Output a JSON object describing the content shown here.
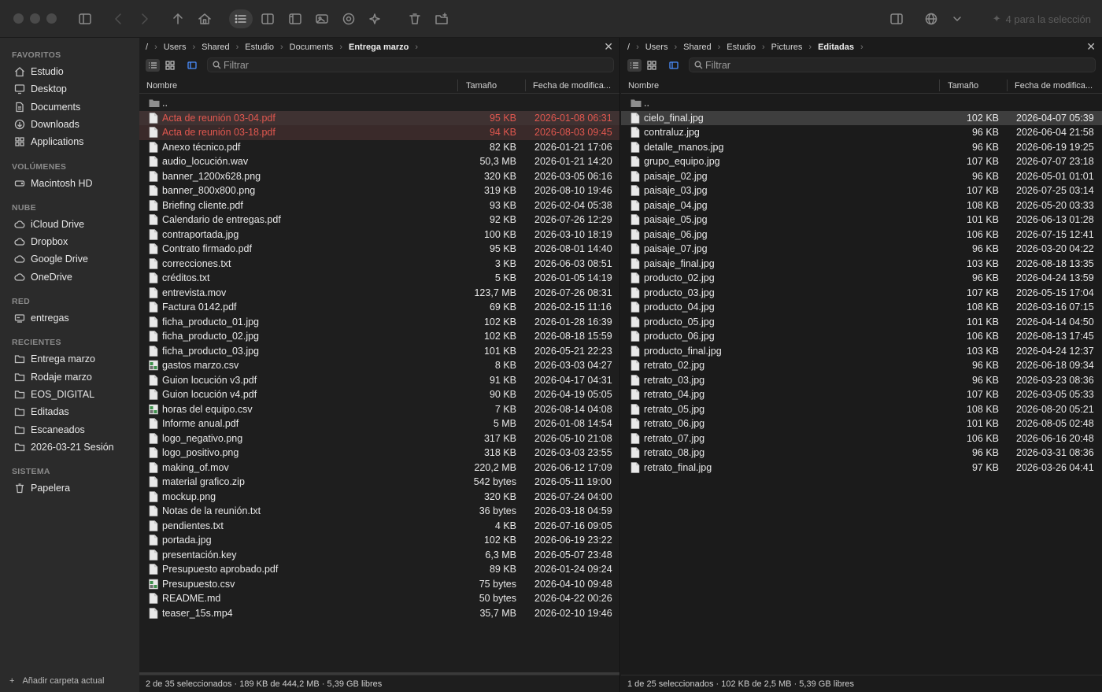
{
  "toolbar": {
    "selection_label": "4 para la selección"
  },
  "sidebar": {
    "sections": [
      {
        "title": "FAVORITOS",
        "items": [
          {
            "label": "Estudio",
            "icon": "home-icon"
          },
          {
            "label": "Desktop",
            "icon": "desktop-icon"
          },
          {
            "label": "Documents",
            "icon": "document-icon"
          },
          {
            "label": "Downloads",
            "icon": "download-icon"
          },
          {
            "label": "Applications",
            "icon": "apps-icon"
          }
        ]
      },
      {
        "title": "VOLÚMENES",
        "items": [
          {
            "label": "Macintosh HD",
            "icon": "drive-icon"
          }
        ]
      },
      {
        "title": "NUBE",
        "items": [
          {
            "label": "iCloud Drive",
            "icon": "cloud-icon"
          },
          {
            "label": "Dropbox",
            "icon": "cloud-icon"
          },
          {
            "label": "Google Drive",
            "icon": "cloud-icon"
          },
          {
            "label": "OneDrive",
            "icon": "cloud-icon"
          }
        ]
      },
      {
        "title": "RED",
        "items": [
          {
            "label": "entregas",
            "icon": "network-drive-icon"
          }
        ]
      },
      {
        "title": "RECIENTES",
        "items": [
          {
            "label": "Entrega marzo",
            "icon": "folder-icon"
          },
          {
            "label": "Rodaje marzo",
            "icon": "folder-icon"
          },
          {
            "label": "EOS_DIGITAL",
            "icon": "folder-icon"
          },
          {
            "label": "Editadas",
            "icon": "folder-icon"
          },
          {
            "label": "Escaneados",
            "icon": "folder-icon"
          },
          {
            "label": "2026-03-21 Sesión",
            "icon": "folder-icon"
          }
        ]
      },
      {
        "title": "SISTEMA",
        "items": [
          {
            "label": "Papelera",
            "icon": "trash-icon"
          }
        ]
      }
    ],
    "add_label": "Añadir carpeta actual"
  },
  "left_pane": {
    "breadcrumb": [
      "/",
      "Users",
      "Shared",
      "Estudio",
      "Documents",
      "Entrega marzo"
    ],
    "filter_placeholder": "Filtrar",
    "columns": {
      "name": "Nombre",
      "size": "Tamaño",
      "date": "Fecha de modifica..."
    },
    "parent": "..",
    "files": [
      {
        "name": "Acta de reunión 03-04.pdf",
        "size": "95 KB",
        "date": "2026-01-08 06:31",
        "state": "selected-red",
        "icon": "doc"
      },
      {
        "name": "Acta de reunión 03-18.pdf",
        "size": "94 KB",
        "date": "2026-08-03 09:45",
        "state": "red",
        "icon": "doc"
      },
      {
        "name": "Anexo técnico.pdf",
        "size": "82 KB",
        "date": "2026-01-21 17:06",
        "state": "",
        "icon": "doc"
      },
      {
        "name": "audio_locución.wav",
        "size": "50,3 MB",
        "date": "2026-01-21 14:20",
        "state": "",
        "icon": "doc"
      },
      {
        "name": "banner_1200x628.png",
        "size": "320 KB",
        "date": "2026-03-05 06:16",
        "state": "",
        "icon": "doc"
      },
      {
        "name": "banner_800x800.png",
        "size": "319 KB",
        "date": "2026-08-10 19:46",
        "state": "",
        "icon": "doc"
      },
      {
        "name": "Briefing cliente.pdf",
        "size": "93 KB",
        "date": "2026-02-04 05:38",
        "state": "",
        "icon": "doc"
      },
      {
        "name": "Calendario de entregas.pdf",
        "size": "92 KB",
        "date": "2026-07-26 12:29",
        "state": "",
        "icon": "doc"
      },
      {
        "name": "contraportada.jpg",
        "size": "100 KB",
        "date": "2026-03-10 18:19",
        "state": "",
        "icon": "doc"
      },
      {
        "name": "Contrato firmado.pdf",
        "size": "95 KB",
        "date": "2026-08-01 14:40",
        "state": "",
        "icon": "doc"
      },
      {
        "name": "correcciones.txt",
        "size": "3 KB",
        "date": "2026-06-03 08:51",
        "state": "",
        "icon": "doc"
      },
      {
        "name": "créditos.txt",
        "size": "5 KB",
        "date": "2026-01-05 14:19",
        "state": "",
        "icon": "doc"
      },
      {
        "name": "entrevista.mov",
        "size": "123,7 MB",
        "date": "2026-07-26 08:31",
        "state": "",
        "icon": "doc"
      },
      {
        "name": "Factura 0142.pdf",
        "size": "69 KB",
        "date": "2026-02-15 11:16",
        "state": "",
        "icon": "doc"
      },
      {
        "name": "ficha_producto_01.jpg",
        "size": "102 KB",
        "date": "2026-01-28 16:39",
        "state": "",
        "icon": "doc"
      },
      {
        "name": "ficha_producto_02.jpg",
        "size": "102 KB",
        "date": "2026-08-18 15:59",
        "state": "",
        "icon": "doc"
      },
      {
        "name": "ficha_producto_03.jpg",
        "size": "101 KB",
        "date": "2026-05-21 22:23",
        "state": "",
        "icon": "doc"
      },
      {
        "name": "gastos marzo.csv",
        "size": "8 KB",
        "date": "2026-03-03 04:27",
        "state": "",
        "icon": "sheet"
      },
      {
        "name": "Guion locución v3.pdf",
        "size": "91 KB",
        "date": "2026-04-17 04:31",
        "state": "",
        "icon": "doc"
      },
      {
        "name": "Guion locución v4.pdf",
        "size": "90 KB",
        "date": "2026-04-19 05:05",
        "state": "",
        "icon": "doc"
      },
      {
        "name": "horas del equipo.csv",
        "size": "7 KB",
        "date": "2026-08-14 04:08",
        "state": "",
        "icon": "sheet"
      },
      {
        "name": "Informe anual.pdf",
        "size": "5 MB",
        "date": "2026-01-08 14:54",
        "state": "",
        "icon": "doc"
      },
      {
        "name": "logo_negativo.png",
        "size": "317 KB",
        "date": "2026-05-10 21:08",
        "state": "",
        "icon": "doc"
      },
      {
        "name": "logo_positivo.png",
        "size": "318 KB",
        "date": "2026-03-03 23:55",
        "state": "",
        "icon": "doc"
      },
      {
        "name": "making_of.mov",
        "size": "220,2 MB",
        "date": "2026-06-12 17:09",
        "state": "",
        "icon": "doc"
      },
      {
        "name": "material grafico.zip",
        "size": "542 bytes",
        "date": "2026-05-11 19:00",
        "state": "",
        "icon": "doc"
      },
      {
        "name": "mockup.png",
        "size": "320 KB",
        "date": "2026-07-24 04:00",
        "state": "",
        "icon": "doc"
      },
      {
        "name": "Notas de la reunión.txt",
        "size": "36 bytes",
        "date": "2026-03-18 04:59",
        "state": "",
        "icon": "doc"
      },
      {
        "name": "pendientes.txt",
        "size": "4 KB",
        "date": "2026-07-16 09:05",
        "state": "",
        "icon": "doc"
      },
      {
        "name": "portada.jpg",
        "size": "102 KB",
        "date": "2026-06-19 23:22",
        "state": "",
        "icon": "doc"
      },
      {
        "name": "presentación.key",
        "size": "6,3 MB",
        "date": "2026-05-07 23:48",
        "state": "",
        "icon": "doc"
      },
      {
        "name": "Presupuesto aprobado.pdf",
        "size": "89 KB",
        "date": "2026-01-24 09:24",
        "state": "",
        "icon": "doc"
      },
      {
        "name": "Presupuesto.csv",
        "size": "75 bytes",
        "date": "2026-04-10 09:48",
        "state": "",
        "icon": "sheet"
      },
      {
        "name": "README.md",
        "size": "50 bytes",
        "date": "2026-04-22 00:26",
        "state": "",
        "icon": "doc"
      },
      {
        "name": "teaser_15s.mp4",
        "size": "35,7 MB",
        "date": "2026-02-10 19:46",
        "state": "",
        "icon": "doc"
      }
    ],
    "status": "2 de 35 seleccionados · 189 KB de 444,2 MB · 5,39 GB libres"
  },
  "right_pane": {
    "breadcrumb": [
      "/",
      "Users",
      "Shared",
      "Estudio",
      "Pictures",
      "Editadas"
    ],
    "filter_placeholder": "Filtrar",
    "columns": {
      "name": "Nombre",
      "size": "Tamaño",
      "date": "Fecha de modifica..."
    },
    "parent": "..",
    "files": [
      {
        "name": "cielo_final.jpg",
        "size": "102 KB",
        "date": "2026-04-07 05:39",
        "state": "selected",
        "icon": "doc"
      },
      {
        "name": "contraluz.jpg",
        "size": "96 KB",
        "date": "2026-06-04 21:58",
        "state": "",
        "icon": "doc"
      },
      {
        "name": "detalle_manos.jpg",
        "size": "96 KB",
        "date": "2026-06-19 19:25",
        "state": "",
        "icon": "doc"
      },
      {
        "name": "grupo_equipo.jpg",
        "size": "107 KB",
        "date": "2026-07-07 23:18",
        "state": "",
        "icon": "doc"
      },
      {
        "name": "paisaje_02.jpg",
        "size": "96 KB",
        "date": "2026-05-01 01:01",
        "state": "",
        "icon": "doc"
      },
      {
        "name": "paisaje_03.jpg",
        "size": "107 KB",
        "date": "2026-07-25 03:14",
        "state": "",
        "icon": "doc"
      },
      {
        "name": "paisaje_04.jpg",
        "size": "108 KB",
        "date": "2026-05-20 03:33",
        "state": "",
        "icon": "doc"
      },
      {
        "name": "paisaje_05.jpg",
        "size": "101 KB",
        "date": "2026-06-13 01:28",
        "state": "",
        "icon": "doc"
      },
      {
        "name": "paisaje_06.jpg",
        "size": "106 KB",
        "date": "2026-07-15 12:41",
        "state": "",
        "icon": "doc"
      },
      {
        "name": "paisaje_07.jpg",
        "size": "96 KB",
        "date": "2026-03-20 04:22",
        "state": "",
        "icon": "doc"
      },
      {
        "name": "paisaje_final.jpg",
        "size": "103 KB",
        "date": "2026-08-18 13:35",
        "state": "",
        "icon": "doc"
      },
      {
        "name": "producto_02.jpg",
        "size": "96 KB",
        "date": "2026-04-24 13:59",
        "state": "",
        "icon": "doc"
      },
      {
        "name": "producto_03.jpg",
        "size": "107 KB",
        "date": "2026-05-15 17:04",
        "state": "",
        "icon": "doc"
      },
      {
        "name": "producto_04.jpg",
        "size": "108 KB",
        "date": "2026-03-16 07:15",
        "state": "",
        "icon": "doc"
      },
      {
        "name": "producto_05.jpg",
        "size": "101 KB",
        "date": "2026-04-14 04:50",
        "state": "",
        "icon": "doc"
      },
      {
        "name": "producto_06.jpg",
        "size": "106 KB",
        "date": "2026-08-13 17:45",
        "state": "",
        "icon": "doc"
      },
      {
        "name": "producto_final.jpg",
        "size": "103 KB",
        "date": "2026-04-24 12:37",
        "state": "",
        "icon": "doc"
      },
      {
        "name": "retrato_02.jpg",
        "size": "96 KB",
        "date": "2026-06-18 09:34",
        "state": "",
        "icon": "doc"
      },
      {
        "name": "retrato_03.jpg",
        "size": "96 KB",
        "date": "2026-03-23 08:36",
        "state": "",
        "icon": "doc"
      },
      {
        "name": "retrato_04.jpg",
        "size": "107 KB",
        "date": "2026-03-05 05:33",
        "state": "",
        "icon": "doc"
      },
      {
        "name": "retrato_05.jpg",
        "size": "108 KB",
        "date": "2026-08-20 05:21",
        "state": "",
        "icon": "doc"
      },
      {
        "name": "retrato_06.jpg",
        "size": "101 KB",
        "date": "2026-08-05 02:48",
        "state": "",
        "icon": "doc"
      },
      {
        "name": "retrato_07.jpg",
        "size": "106 KB",
        "date": "2026-06-16 20:48",
        "state": "",
        "icon": "doc"
      },
      {
        "name": "retrato_08.jpg",
        "size": "96 KB",
        "date": "2026-03-31 08:36",
        "state": "",
        "icon": "doc"
      },
      {
        "name": "retrato_final.jpg",
        "size": "97 KB",
        "date": "2026-03-26 04:41",
        "state": "",
        "icon": "doc"
      }
    ],
    "status": "1 de 25 seleccionados · 102 KB de 2,5 MB · 5,39 GB libres"
  },
  "colors": {
    "accent_blue": "#4a8eff",
    "tagged_red": "#e0574f"
  }
}
